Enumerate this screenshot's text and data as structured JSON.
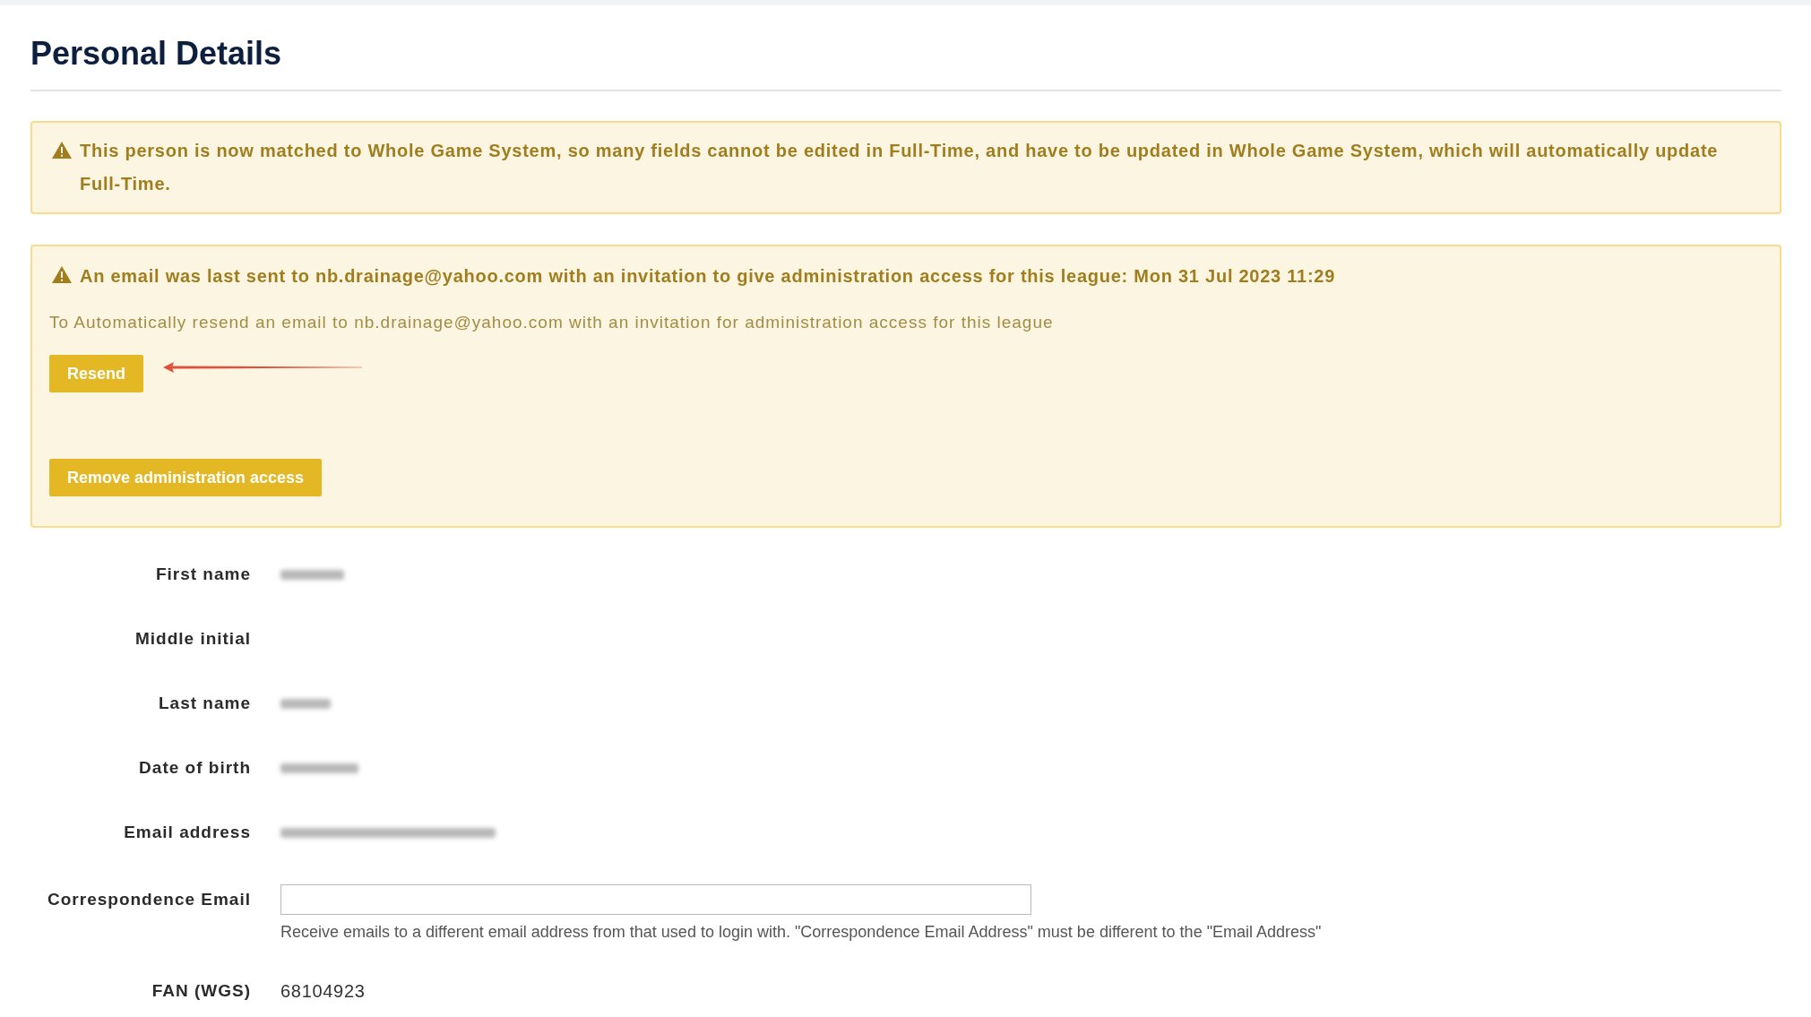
{
  "page_title": "Personal Details",
  "match_alert": {
    "message": "This person is now matched to Whole Game System, so many fields cannot be edited in Full-Time, and have to be updated in Whole Game System, which will automatically update Full-Time."
  },
  "invitation_alert": {
    "message": "An email was last sent to nb.drainage@yahoo.com with an invitation to give administration access for this league: Mon 31 Jul 2023 11:29",
    "detail": "To Automatically resend an email to nb.drainage@yahoo.com with an invitation for administration access for this league",
    "resend_button": "Resend",
    "remove_button": "Remove administration access"
  },
  "fields": [
    {
      "kind": "text",
      "label": "First name",
      "blurred": true
    },
    {
      "kind": "text",
      "label": "Middle initial",
      "blurred": false
    },
    {
      "kind": "text",
      "label": "Last name",
      "blurred": true
    },
    {
      "kind": "text",
      "label": "Date of birth",
      "blurred": true
    },
    {
      "kind": "text",
      "label": "Email address",
      "blurred": true
    },
    {
      "kind": "input",
      "label": "Correspondence Email",
      "help": "Receive emails to a different email address from that used to login with. \"Correspondence Email Address\" must be different to the \"Email Address\""
    },
    {
      "kind": "text",
      "label": "FAN (WGS)",
      "blurred": false,
      "value": "68104923"
    }
  ]
}
